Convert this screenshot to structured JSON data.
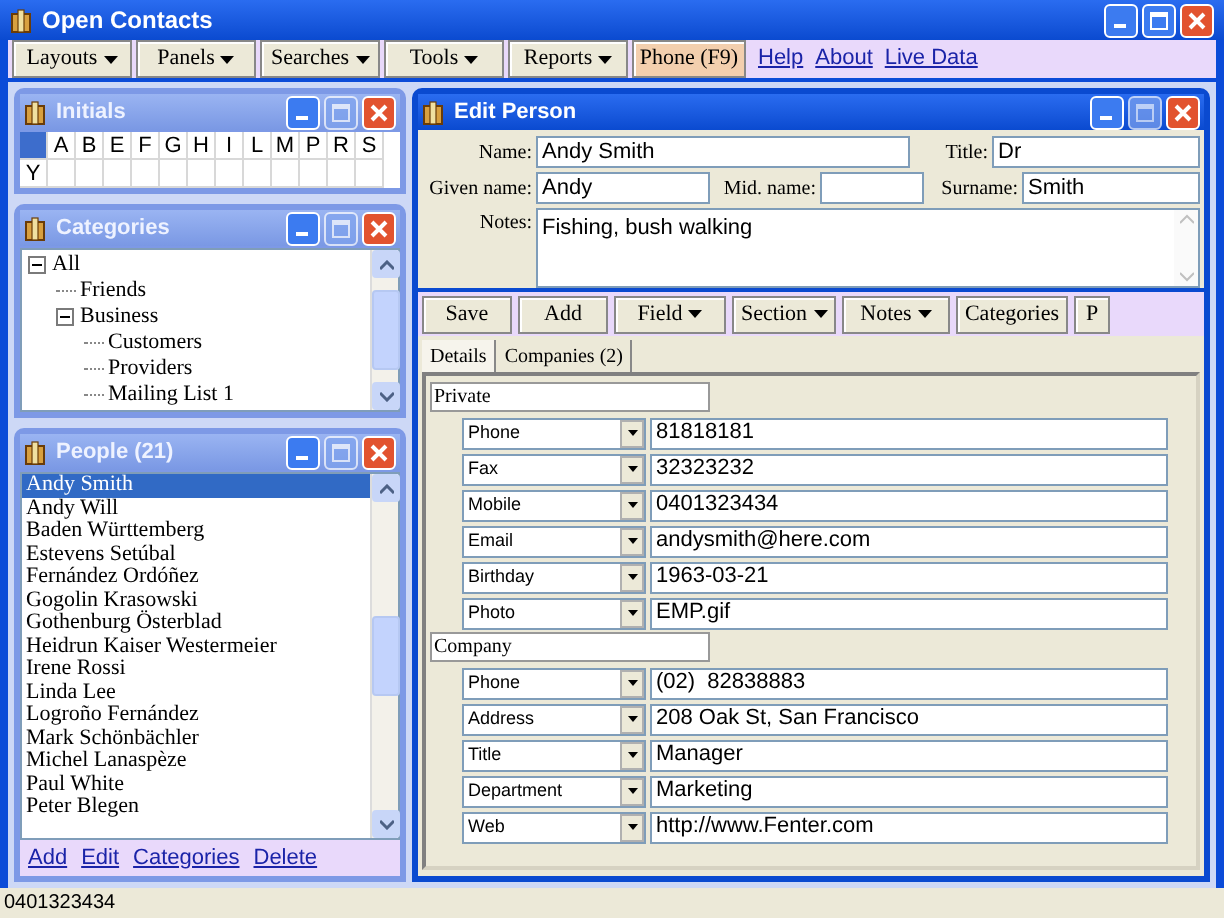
{
  "window": {
    "title": "Open Contacts"
  },
  "toolbar": [
    {
      "label": "Layouts",
      "kind": "menu"
    },
    {
      "label": "Panels",
      "kind": "menu"
    },
    {
      "label": "Searches",
      "kind": "menu"
    },
    {
      "label": "Tools",
      "kind": "menu"
    },
    {
      "label": "Reports",
      "kind": "menu"
    },
    {
      "label": "Phone (F9)",
      "kind": "button"
    }
  ],
  "links": [
    "Help",
    "About",
    "Live Data"
  ],
  "initials": {
    "title": "Initials",
    "all_selected": true,
    "letters": [
      {
        "label": "A",
        "selected": false
      },
      {
        "label": "B",
        "selected": false
      },
      {
        "label": "E",
        "selected": false
      },
      {
        "label": "F",
        "selected": false
      },
      {
        "label": "G",
        "selected": false
      },
      {
        "label": "H",
        "selected": false
      },
      {
        "label": "I",
        "selected": false
      },
      {
        "label": "L",
        "selected": false
      },
      {
        "label": "M",
        "selected": false
      },
      {
        "label": "P",
        "selected": false
      },
      {
        "label": "R",
        "selected": false
      },
      {
        "label": "S",
        "selected": false
      },
      {
        "label": "Y",
        "selected": false
      }
    ]
  },
  "categories": {
    "title": "Categories",
    "tree": [
      {
        "label": "All",
        "expanded": true,
        "children": [
          {
            "label": "Friends"
          },
          {
            "label": "Business",
            "expanded": true,
            "children": [
              {
                "label": "Customers"
              },
              {
                "label": "Providers"
              },
              {
                "label": "Mailing List 1"
              }
            ]
          }
        ]
      }
    ]
  },
  "people": {
    "title": "People (21)",
    "items": [
      {
        "label": "Andy Smith",
        "selected": true
      },
      {
        "label": "Andy Will",
        "selected": false
      },
      {
        "label": "Baden Württemberg",
        "selected": false
      },
      {
        "label": "Estevens Setúbal",
        "selected": false
      },
      {
        "label": "Fernández Ordóñez",
        "selected": false
      },
      {
        "label": "Gogolin Krasowski",
        "selected": false
      },
      {
        "label": "Gothenburg Österblad",
        "selected": false
      },
      {
        "label": "Heidrun Kaiser Westermeier",
        "selected": false
      },
      {
        "label": "Irene Rossi",
        "selected": false
      },
      {
        "label": "Linda Lee",
        "selected": false
      },
      {
        "label": "Logroño Fernández",
        "selected": false
      },
      {
        "label": "Mark Schönbächler",
        "selected": false
      },
      {
        "label": "Michel Lanaspèze",
        "selected": false
      },
      {
        "label": "Paul White",
        "selected": false
      },
      {
        "label": "Peter Blegen",
        "selected": false
      }
    ],
    "actions": [
      "Add",
      "Edit",
      "Categories",
      "Delete"
    ]
  },
  "edit_person": {
    "title": "Edit Person",
    "name": {
      "label": "Name:",
      "value": "Andy Smith"
    },
    "title_field": {
      "label": "Title:",
      "value": "Dr"
    },
    "given_name": {
      "label": "Given name:",
      "value": "Andy"
    },
    "mid_name": {
      "label": "Mid. name:"
    },
    "surname": {
      "label": "Surname:",
      "value": "Smith"
    },
    "notes": {
      "label": "Notes:",
      "value": "Fishing, bush walking"
    },
    "buttons": [
      {
        "label": "Save",
        "kind": "button"
      },
      {
        "label": "Add",
        "kind": "button"
      },
      {
        "label": "Field",
        "kind": "menu"
      },
      {
        "label": "Section",
        "kind": "menu"
      },
      {
        "label": "Notes",
        "kind": "menu"
      },
      {
        "label": "Categories",
        "kind": "button"
      },
      {
        "label": "P",
        "kind": "button"
      }
    ],
    "tabs": [
      {
        "label": "Details",
        "selected": true
      },
      {
        "label": "Companies (2)",
        "selected": false
      }
    ],
    "sections": [
      {
        "title": "Private",
        "rows": [
          {
            "type": "Phone",
            "value": "81818181"
          },
          {
            "type": "Fax",
            "value": "32323232"
          },
          {
            "type": "Mobile",
            "value": "0401323434"
          },
          {
            "type": "Email",
            "value": "andysmith@here.com"
          },
          {
            "type": "Birthday",
            "value": "1963-03-21"
          },
          {
            "type": "Photo",
            "value": "EMP.gif"
          }
        ]
      },
      {
        "title": "Company",
        "rows": [
          {
            "type": "Phone",
            "value": "(02)  82838883"
          },
          {
            "type": "Address",
            "value": "208 Oak St, San Francisco"
          },
          {
            "type": "Title",
            "value": "Manager"
          },
          {
            "type": "Department",
            "value": "Marketing"
          },
          {
            "type": "Web",
            "value": "http://www.Fenter.com"
          }
        ]
      }
    ]
  },
  "status_bar": {
    "text": "0401323434"
  }
}
